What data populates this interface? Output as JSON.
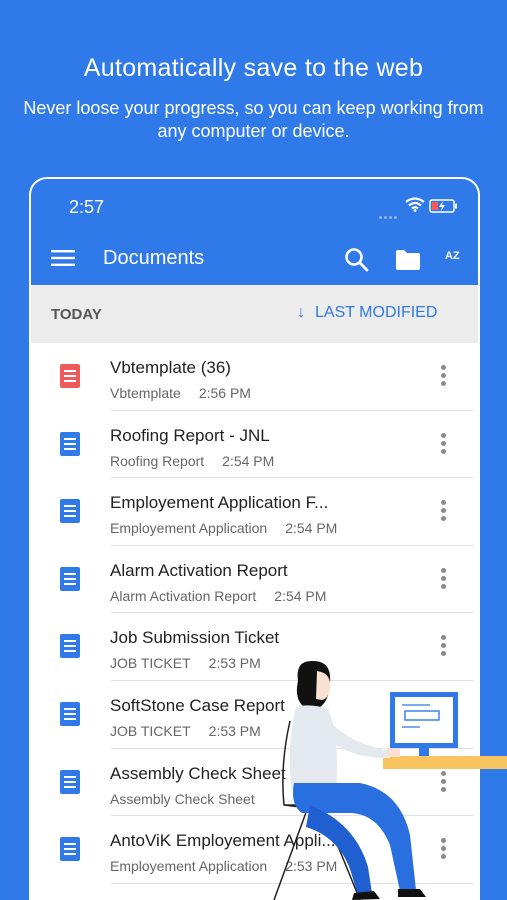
{
  "promo": {
    "headline": "Automatically save to the web",
    "subline": "Never loose your progress, so you can keep working from any computer or device."
  },
  "status_bar": {
    "time": "2:57"
  },
  "app_bar": {
    "title": "Documents",
    "sort_az_label": "AZ"
  },
  "section": {
    "label": "TODAY",
    "sort_label": "LAST MODIFIED"
  },
  "colors": {
    "primary": "#2f7ae8",
    "doc_blue": "#2f7ae8",
    "doc_red": "#ef5a5a"
  },
  "documents": [
    {
      "name": "Vbtemplate (36)",
      "template": "Vbtemplate",
      "time": "2:56 PM",
      "icon_color": "red"
    },
    {
      "name": "Roofing Report - JNL",
      "template": "Roofing Report",
      "time": "2:54 PM",
      "icon_color": "blue"
    },
    {
      "name": "Employement Application F...",
      "template": "Employement Application",
      "time": "2:54 PM",
      "icon_color": "blue"
    },
    {
      "name": "Alarm Activation Report",
      "template": "Alarm Activation Report",
      "time": "2:54 PM",
      "icon_color": "blue"
    },
    {
      "name": "Job Submission Ticket",
      "template": "JOB TICKET",
      "time": "2:53 PM",
      "icon_color": "blue"
    },
    {
      "name": "SoftStone Case Report",
      "template": "JOB TICKET",
      "time": "2:53 PM",
      "icon_color": "blue"
    },
    {
      "name": "Assembly Check Sheet for I...",
      "template": "Assembly Check Sheet",
      "time": "",
      "icon_color": "blue"
    },
    {
      "name": "AntoViK Employement Appli...",
      "template": "Employement Application",
      "time": "2:53 PM",
      "icon_color": "blue"
    }
  ]
}
